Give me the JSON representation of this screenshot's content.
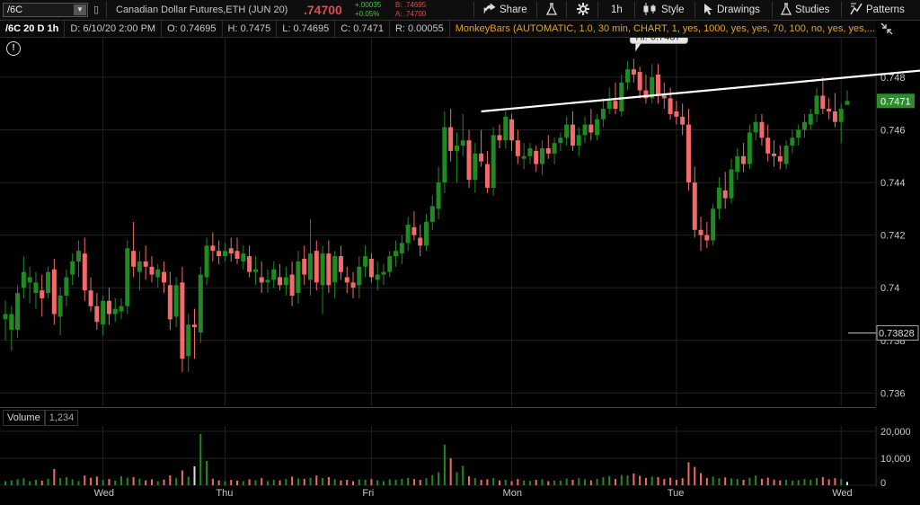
{
  "toolbar": {
    "symbol": "/6C",
    "symbol_desc": "Canadian Dollar Futures,ETH (JUN 20)",
    "last_price": ".74700",
    "net_change": "+.00035",
    "pct_change": "+0.05%",
    "bid": "B: .74695",
    "ask": "A: .74700",
    "share_label": "Share",
    "timeframe_label": "1h",
    "style_label": "Style",
    "drawings_label": "Drawings",
    "studies_label": "Studies",
    "patterns_label": "Patterns"
  },
  "header": {
    "title": "/6C 20 D 1h",
    "date": "D: 6/10/20 2:00 PM",
    "open": "O: 0.74695",
    "high": "H: 0.7475",
    "low": "L: 0.74695",
    "close": "C: 0.7471",
    "range": "R: 0.00055",
    "study": "MonkeyBars (AUTOMATIC, 1.0, 30 min, CHART, 1, yes, 1000, yes, yes, 70, 100, no, yes, yes,..."
  },
  "price_axis": {
    "ticks": [
      "0.748",
      "0.746",
      "0.744",
      "0.742",
      "0.74",
      "0.738",
      "0.736"
    ],
    "current_price_label": "0.7471",
    "marker_label": "0.73828",
    "hi_label": "Hi: 0.7487"
  },
  "volume": {
    "title": "Volume",
    "value": "1,234",
    "ticks": [
      "20,000",
      "10,000",
      "0"
    ]
  },
  "day_labels": [
    "Wed",
    "Thu",
    "Fri",
    "Mon",
    "Tue",
    "Wed"
  ],
  "colors": {
    "up": "#1f8a1f",
    "down": "#f46a6a",
    "grid": "#222222",
    "study": "#e2a22b",
    "price_tag": "#2e8b2e"
  },
  "chart_data": {
    "type": "candlestick",
    "interval": "1h",
    "ylim": [
      0.7355,
      0.7495
    ],
    "volume_ylim": [
      0,
      22000
    ],
    "candles": [
      {
        "o": 0.7388,
        "h": 0.7395,
        "l": 0.738,
        "c": 0.739,
        "v": 1500
      },
      {
        "o": 0.7384,
        "h": 0.7393,
        "l": 0.7376,
        "c": 0.739,
        "v": 1800
      },
      {
        "o": 0.7384,
        "h": 0.7401,
        "l": 0.7381,
        "c": 0.7398,
        "v": 2200
      },
      {
        "o": 0.74,
        "h": 0.7412,
        "l": 0.7396,
        "c": 0.7406,
        "v": 2600
      },
      {
        "o": 0.7402,
        "h": 0.7408,
        "l": 0.7394,
        "c": 0.7404,
        "v": 1500
      },
      {
        "o": 0.7398,
        "h": 0.7406,
        "l": 0.7392,
        "c": 0.7402,
        "v": 2000
      },
      {
        "o": 0.7399,
        "h": 0.7405,
        "l": 0.7389,
        "c": 0.7396,
        "v": 1700
      },
      {
        "o": 0.7398,
        "h": 0.7408,
        "l": 0.7396,
        "c": 0.7406,
        "v": 2400
      },
      {
        "o": 0.7407,
        "h": 0.7411,
        "l": 0.7386,
        "c": 0.739,
        "v": 6000
      },
      {
        "o": 0.7389,
        "h": 0.74,
        "l": 0.7382,
        "c": 0.7397,
        "v": 2600
      },
      {
        "o": 0.7397,
        "h": 0.7407,
        "l": 0.7393,
        "c": 0.7404,
        "v": 3000
      },
      {
        "o": 0.7405,
        "h": 0.7413,
        "l": 0.7401,
        "c": 0.741,
        "v": 2200
      },
      {
        "o": 0.741,
        "h": 0.7418,
        "l": 0.7404,
        "c": 0.7414,
        "v": 1500
      },
      {
        "o": 0.7413,
        "h": 0.7419,
        "l": 0.7395,
        "c": 0.7399,
        "v": 3600
      },
      {
        "o": 0.7399,
        "h": 0.7404,
        "l": 0.7391,
        "c": 0.7393,
        "v": 2800
      },
      {
        "o": 0.7393,
        "h": 0.7398,
        "l": 0.7384,
        "c": 0.7387,
        "v": 3200
      },
      {
        "o": 0.7386,
        "h": 0.7397,
        "l": 0.7382,
        "c": 0.7395,
        "v": 2000
      },
      {
        "o": 0.7395,
        "h": 0.74,
        "l": 0.7386,
        "c": 0.739,
        "v": 2300
      },
      {
        "o": 0.739,
        "h": 0.7396,
        "l": 0.7387,
        "c": 0.7392,
        "v": 1700
      },
      {
        "o": 0.7391,
        "h": 0.7396,
        "l": 0.7388,
        "c": 0.7393,
        "v": 3300
      },
      {
        "o": 0.7393,
        "h": 0.7418,
        "l": 0.739,
        "c": 0.7415,
        "v": 2800
      },
      {
        "o": 0.7414,
        "h": 0.7425,
        "l": 0.7404,
        "c": 0.7408,
        "v": 3000
      },
      {
        "o": 0.7406,
        "h": 0.7414,
        "l": 0.7399,
        "c": 0.741,
        "v": 2400
      },
      {
        "o": 0.741,
        "h": 0.7416,
        "l": 0.7403,
        "c": 0.7408,
        "v": 1800
      },
      {
        "o": 0.7408,
        "h": 0.7412,
        "l": 0.7402,
        "c": 0.7405,
        "v": 2200
      },
      {
        "o": 0.7404,
        "h": 0.7409,
        "l": 0.74,
        "c": 0.7407,
        "v": 1500
      },
      {
        "o": 0.7406,
        "h": 0.741,
        "l": 0.7398,
        "c": 0.7402,
        "v": 2100
      },
      {
        "o": 0.7401,
        "h": 0.7406,
        "l": 0.7384,
        "c": 0.7388,
        "v": 3700
      },
      {
        "o": 0.7389,
        "h": 0.7404,
        "l": 0.7385,
        "c": 0.7401,
        "v": 2600
      },
      {
        "o": 0.7402,
        "h": 0.7408,
        "l": 0.7368,
        "c": 0.7373,
        "v": 5500
      },
      {
        "o": 0.7374,
        "h": 0.739,
        "l": 0.7368,
        "c": 0.7386,
        "v": 3200
      },
      {
        "o": 0.7386,
        "h": 0.7392,
        "l": 0.7373,
        "c": 0.7385,
        "v": 7000
      },
      {
        "o": 0.7383,
        "h": 0.7408,
        "l": 0.7379,
        "c": 0.7405,
        "v": 19000
      },
      {
        "o": 0.7404,
        "h": 0.7419,
        "l": 0.7401,
        "c": 0.7416,
        "v": 9000
      },
      {
        "o": 0.7416,
        "h": 0.7421,
        "l": 0.741,
        "c": 0.7414,
        "v": 2400
      },
      {
        "o": 0.7414,
        "h": 0.7418,
        "l": 0.7409,
        "c": 0.7412,
        "v": 1800
      },
      {
        "o": 0.7412,
        "h": 0.7417,
        "l": 0.741,
        "c": 0.7414,
        "v": 1500
      },
      {
        "o": 0.7415,
        "h": 0.7419,
        "l": 0.741,
        "c": 0.7413,
        "v": 2000
      },
      {
        "o": 0.7414,
        "h": 0.7419,
        "l": 0.7409,
        "c": 0.7411,
        "v": 1700
      },
      {
        "o": 0.741,
        "h": 0.7416,
        "l": 0.7407,
        "c": 0.7413,
        "v": 1500
      },
      {
        "o": 0.7412,
        "h": 0.7416,
        "l": 0.7404,
        "c": 0.7406,
        "v": 2200
      },
      {
        "o": 0.7406,
        "h": 0.7412,
        "l": 0.7401,
        "c": 0.7407,
        "v": 1800
      },
      {
        "o": 0.7404,
        "h": 0.741,
        "l": 0.7398,
        "c": 0.7402,
        "v": 2600
      },
      {
        "o": 0.7402,
        "h": 0.7407,
        "l": 0.7398,
        "c": 0.7403,
        "v": 1500
      },
      {
        "o": 0.7403,
        "h": 0.741,
        "l": 0.74,
        "c": 0.7407,
        "v": 2000
      },
      {
        "o": 0.7404,
        "h": 0.7409,
        "l": 0.7399,
        "c": 0.7401,
        "v": 1800
      },
      {
        "o": 0.7401,
        "h": 0.7408,
        "l": 0.7397,
        "c": 0.7404,
        "v": 2300
      },
      {
        "o": 0.7405,
        "h": 0.741,
        "l": 0.7393,
        "c": 0.7397,
        "v": 3200
      },
      {
        "o": 0.7398,
        "h": 0.7414,
        "l": 0.7394,
        "c": 0.741,
        "v": 2500
      },
      {
        "o": 0.7411,
        "h": 0.7416,
        "l": 0.7401,
        "c": 0.7405,
        "v": 2400
      },
      {
        "o": 0.7403,
        "h": 0.7426,
        "l": 0.7397,
        "c": 0.7413,
        "v": 2800
      },
      {
        "o": 0.7414,
        "h": 0.7418,
        "l": 0.7399,
        "c": 0.7402,
        "v": 3600
      },
      {
        "o": 0.7401,
        "h": 0.7416,
        "l": 0.739,
        "c": 0.7413,
        "v": 2700
      },
      {
        "o": 0.7413,
        "h": 0.7418,
        "l": 0.7398,
        "c": 0.7401,
        "v": 3000
      },
      {
        "o": 0.7402,
        "h": 0.7414,
        "l": 0.7396,
        "c": 0.7412,
        "v": 2200
      },
      {
        "o": 0.7412,
        "h": 0.7416,
        "l": 0.7403,
        "c": 0.7406,
        "v": 1800
      },
      {
        "o": 0.7404,
        "h": 0.7408,
        "l": 0.7398,
        "c": 0.7402,
        "v": 2000
      },
      {
        "o": 0.7402,
        "h": 0.7406,
        "l": 0.7396,
        "c": 0.74,
        "v": 1500
      },
      {
        "o": 0.7401,
        "h": 0.7412,
        "l": 0.7396,
        "c": 0.7408,
        "v": 2200
      },
      {
        "o": 0.7408,
        "h": 0.7416,
        "l": 0.7404,
        "c": 0.7412,
        "v": 2000
      },
      {
        "o": 0.7411,
        "h": 0.7413,
        "l": 0.7402,
        "c": 0.7404,
        "v": 2300
      },
      {
        "o": 0.7403,
        "h": 0.741,
        "l": 0.7399,
        "c": 0.7405,
        "v": 1800
      },
      {
        "o": 0.7405,
        "h": 0.7409,
        "l": 0.7401,
        "c": 0.7406,
        "v": 1500
      },
      {
        "o": 0.7406,
        "h": 0.7414,
        "l": 0.7404,
        "c": 0.7412,
        "v": 2200
      },
      {
        "o": 0.7412,
        "h": 0.7418,
        "l": 0.7408,
        "c": 0.7414,
        "v": 2000
      },
      {
        "o": 0.7413,
        "h": 0.742,
        "l": 0.7409,
        "c": 0.7417,
        "v": 2400
      },
      {
        "o": 0.7417,
        "h": 0.7427,
        "l": 0.7414,
        "c": 0.7424,
        "v": 2700
      },
      {
        "o": 0.7423,
        "h": 0.7429,
        "l": 0.7418,
        "c": 0.742,
        "v": 2300
      },
      {
        "o": 0.7419,
        "h": 0.7424,
        "l": 0.7412,
        "c": 0.7416,
        "v": 2000
      },
      {
        "o": 0.7416,
        "h": 0.7428,
        "l": 0.7414,
        "c": 0.7425,
        "v": 2600
      },
      {
        "o": 0.7425,
        "h": 0.7435,
        "l": 0.7422,
        "c": 0.7431,
        "v": 3800
      },
      {
        "o": 0.743,
        "h": 0.7446,
        "l": 0.7426,
        "c": 0.744,
        "v": 4800
      },
      {
        "o": 0.744,
        "h": 0.7467,
        "l": 0.7436,
        "c": 0.7461,
        "v": 15000
      },
      {
        "o": 0.7461,
        "h": 0.7468,
        "l": 0.7448,
        "c": 0.7452,
        "v": 10000
      },
      {
        "o": 0.7452,
        "h": 0.7459,
        "l": 0.744,
        "c": 0.7454,
        "v": 4800
      },
      {
        "o": 0.7454,
        "h": 0.7466,
        "l": 0.745,
        "c": 0.7456,
        "v": 7200
      },
      {
        "o": 0.7456,
        "h": 0.746,
        "l": 0.7438,
        "c": 0.7441,
        "v": 3300
      },
      {
        "o": 0.7441,
        "h": 0.7455,
        "l": 0.7436,
        "c": 0.7451,
        "v": 2600
      },
      {
        "o": 0.7451,
        "h": 0.746,
        "l": 0.7446,
        "c": 0.7448,
        "v": 2000
      },
      {
        "o": 0.7447,
        "h": 0.7452,
        "l": 0.7436,
        "c": 0.7438,
        "v": 2200
      },
      {
        "o": 0.7438,
        "h": 0.7461,
        "l": 0.7435,
        "c": 0.7458,
        "v": 2700
      },
      {
        "o": 0.7458,
        "h": 0.7462,
        "l": 0.7453,
        "c": 0.7456,
        "v": 1800
      },
      {
        "o": 0.7456,
        "h": 0.7467,
        "l": 0.7453,
        "c": 0.7465,
        "v": 2000
      },
      {
        "o": 0.7464,
        "h": 0.7466,
        "l": 0.7452,
        "c": 0.7456,
        "v": 1500
      },
      {
        "o": 0.7456,
        "h": 0.746,
        "l": 0.7447,
        "c": 0.745,
        "v": 2300
      },
      {
        "o": 0.7449,
        "h": 0.7455,
        "l": 0.7445,
        "c": 0.745,
        "v": 1800
      },
      {
        "o": 0.745,
        "h": 0.7455,
        "l": 0.7447,
        "c": 0.7453,
        "v": 1600
      },
      {
        "o": 0.7452,
        "h": 0.7454,
        "l": 0.7444,
        "c": 0.7447,
        "v": 2000
      },
      {
        "o": 0.7447,
        "h": 0.7456,
        "l": 0.7443,
        "c": 0.7453,
        "v": 2200
      },
      {
        "o": 0.7453,
        "h": 0.7458,
        "l": 0.7449,
        "c": 0.7451,
        "v": 1500
      },
      {
        "o": 0.7451,
        "h": 0.7457,
        "l": 0.7447,
        "c": 0.7455,
        "v": 1800
      },
      {
        "o": 0.7455,
        "h": 0.7459,
        "l": 0.7452,
        "c": 0.7457,
        "v": 1700
      },
      {
        "o": 0.7457,
        "h": 0.7465,
        "l": 0.7454,
        "c": 0.7462,
        "v": 2500
      },
      {
        "o": 0.7462,
        "h": 0.7467,
        "l": 0.7452,
        "c": 0.7454,
        "v": 2000
      },
      {
        "o": 0.7454,
        "h": 0.7461,
        "l": 0.745,
        "c": 0.7458,
        "v": 2600
      },
      {
        "o": 0.7458,
        "h": 0.7465,
        "l": 0.7455,
        "c": 0.7462,
        "v": 2200
      },
      {
        "o": 0.7462,
        "h": 0.7468,
        "l": 0.7456,
        "c": 0.7459,
        "v": 1800
      },
      {
        "o": 0.7458,
        "h": 0.7466,
        "l": 0.7456,
        "c": 0.7464,
        "v": 2400
      },
      {
        "o": 0.7464,
        "h": 0.7472,
        "l": 0.7461,
        "c": 0.7468,
        "v": 3000
      },
      {
        "o": 0.7468,
        "h": 0.7476,
        "l": 0.7466,
        "c": 0.7471,
        "v": 3400
      },
      {
        "o": 0.7471,
        "h": 0.7478,
        "l": 0.7466,
        "c": 0.7468,
        "v": 2300
      },
      {
        "o": 0.7467,
        "h": 0.7481,
        "l": 0.7465,
        "c": 0.7478,
        "v": 3800
      },
      {
        "o": 0.7478,
        "h": 0.7486,
        "l": 0.7475,
        "c": 0.7483,
        "v": 3600
      },
      {
        "o": 0.7483,
        "h": 0.7487,
        "l": 0.7478,
        "c": 0.7481,
        "v": 4400
      },
      {
        "o": 0.7482,
        "h": 0.7484,
        "l": 0.7472,
        "c": 0.7475,
        "v": 3500
      },
      {
        "o": 0.7475,
        "h": 0.7481,
        "l": 0.747,
        "c": 0.7472,
        "v": 2700
      },
      {
        "o": 0.7472,
        "h": 0.7485,
        "l": 0.747,
        "c": 0.748,
        "v": 3200
      },
      {
        "o": 0.7481,
        "h": 0.7485,
        "l": 0.747,
        "c": 0.7473,
        "v": 3000
      },
      {
        "o": 0.7473,
        "h": 0.7478,
        "l": 0.7468,
        "c": 0.7472,
        "v": 2300
      },
      {
        "o": 0.7472,
        "h": 0.7476,
        "l": 0.7464,
        "c": 0.7466,
        "v": 2800
      },
      {
        "o": 0.7467,
        "h": 0.7471,
        "l": 0.7462,
        "c": 0.7465,
        "v": 2000
      },
      {
        "o": 0.7465,
        "h": 0.747,
        "l": 0.7458,
        "c": 0.7462,
        "v": 2600
      },
      {
        "o": 0.7462,
        "h": 0.7468,
        "l": 0.7437,
        "c": 0.744,
        "v": 8500
      },
      {
        "o": 0.744,
        "h": 0.7446,
        "l": 0.7419,
        "c": 0.7422,
        "v": 6800
      },
      {
        "o": 0.7422,
        "h": 0.7427,
        "l": 0.7414,
        "c": 0.742,
        "v": 4500
      },
      {
        "o": 0.742,
        "h": 0.7425,
        "l": 0.7415,
        "c": 0.7418,
        "v": 2700
      },
      {
        "o": 0.7418,
        "h": 0.7432,
        "l": 0.7416,
        "c": 0.743,
        "v": 3200
      },
      {
        "o": 0.743,
        "h": 0.7442,
        "l": 0.7426,
        "c": 0.7438,
        "v": 2600
      },
      {
        "o": 0.7437,
        "h": 0.7444,
        "l": 0.743,
        "c": 0.7434,
        "v": 2900
      },
      {
        "o": 0.7434,
        "h": 0.7449,
        "l": 0.7432,
        "c": 0.7445,
        "v": 2500
      },
      {
        "o": 0.7444,
        "h": 0.7453,
        "l": 0.7441,
        "c": 0.745,
        "v": 2300
      },
      {
        "o": 0.745,
        "h": 0.7455,
        "l": 0.7444,
        "c": 0.7447,
        "v": 2000
      },
      {
        "o": 0.7447,
        "h": 0.7462,
        "l": 0.7445,
        "c": 0.7459,
        "v": 2800
      },
      {
        "o": 0.7459,
        "h": 0.7466,
        "l": 0.7456,
        "c": 0.7463,
        "v": 3600
      },
      {
        "o": 0.7463,
        "h": 0.7466,
        "l": 0.7454,
        "c": 0.7457,
        "v": 2400
      },
      {
        "o": 0.7457,
        "h": 0.7462,
        "l": 0.7448,
        "c": 0.7451,
        "v": 2800
      },
      {
        "o": 0.7451,
        "h": 0.7456,
        "l": 0.7446,
        "c": 0.745,
        "v": 2100
      },
      {
        "o": 0.745,
        "h": 0.7454,
        "l": 0.7445,
        "c": 0.7448,
        "v": 1800
      },
      {
        "o": 0.7447,
        "h": 0.7456,
        "l": 0.7445,
        "c": 0.7454,
        "v": 2000
      },
      {
        "o": 0.7454,
        "h": 0.746,
        "l": 0.7451,
        "c": 0.7457,
        "v": 1700
      },
      {
        "o": 0.7457,
        "h": 0.7462,
        "l": 0.7454,
        "c": 0.746,
        "v": 1900
      },
      {
        "o": 0.746,
        "h": 0.7466,
        "l": 0.7457,
        "c": 0.7463,
        "v": 2300
      },
      {
        "o": 0.7462,
        "h": 0.7468,
        "l": 0.746,
        "c": 0.7466,
        "v": 2000
      },
      {
        "o": 0.7466,
        "h": 0.7476,
        "l": 0.7463,
        "c": 0.7473,
        "v": 2700
      },
      {
        "o": 0.7473,
        "h": 0.748,
        "l": 0.7466,
        "c": 0.7468,
        "v": 3000
      },
      {
        "o": 0.7468,
        "h": 0.7472,
        "l": 0.7464,
        "c": 0.7467,
        "v": 2200
      },
      {
        "o": 0.7467,
        "h": 0.7474,
        "l": 0.7461,
        "c": 0.7463,
        "v": 2600
      },
      {
        "o": 0.7463,
        "h": 0.747,
        "l": 0.7455,
        "c": 0.7468,
        "v": 2300
      },
      {
        "o": 0.74695,
        "h": 0.7475,
        "l": 0.74695,
        "c": 0.7471,
        "v": 1234
      }
    ],
    "trendline": {
      "start_index": 78,
      "start_price": 0.7467,
      "end_index": 157,
      "end_price": 0.7484
    }
  }
}
